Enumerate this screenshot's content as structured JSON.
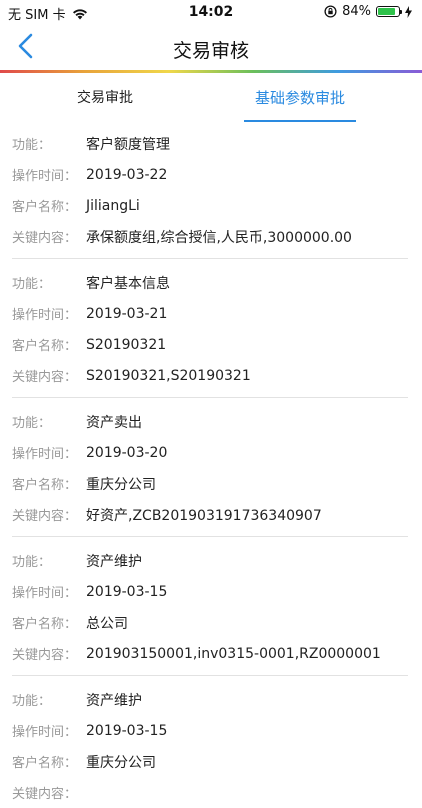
{
  "status_bar": {
    "carrier": "无 SIM 卡",
    "time": "14:02",
    "battery_percent": "84%",
    "battery_level": 0.84
  },
  "nav": {
    "title": "交易审核"
  },
  "tabs": [
    {
      "label": "交易审批",
      "active": false
    },
    {
      "label": "基础参数审批",
      "active": true
    }
  ],
  "labels": {
    "function": "功能：",
    "op_time": "操作时间：",
    "customer": "客户名称：",
    "key_content": "关键内容："
  },
  "records": [
    {
      "function": "客户额度管理",
      "op_time": "2019-03-22",
      "customer": "JiliangLi",
      "key_content": "承保额度组,综合授信,人民币,3000000.00"
    },
    {
      "function": "客户基本信息",
      "op_time": "2019-03-21",
      "customer": "S20190321",
      "key_content": "S20190321,S20190321"
    },
    {
      "function": "资产卖出",
      "op_time": "2019-03-20",
      "customer": "重庆分公司",
      "key_content": "好资产,ZCB201903191736340907"
    },
    {
      "function": "资产维护",
      "op_time": "2019-03-15",
      "customer": "总公司",
      "key_content": "201903150001,inv0315-0001,RZ0000001"
    },
    {
      "function": "资产维护",
      "op_time": "2019-03-15",
      "customer": "重庆分公司",
      "key_content": ""
    }
  ],
  "colors": {
    "accent": "#2a8ae0",
    "label": "#999999",
    "battery": "#2ec24a"
  }
}
